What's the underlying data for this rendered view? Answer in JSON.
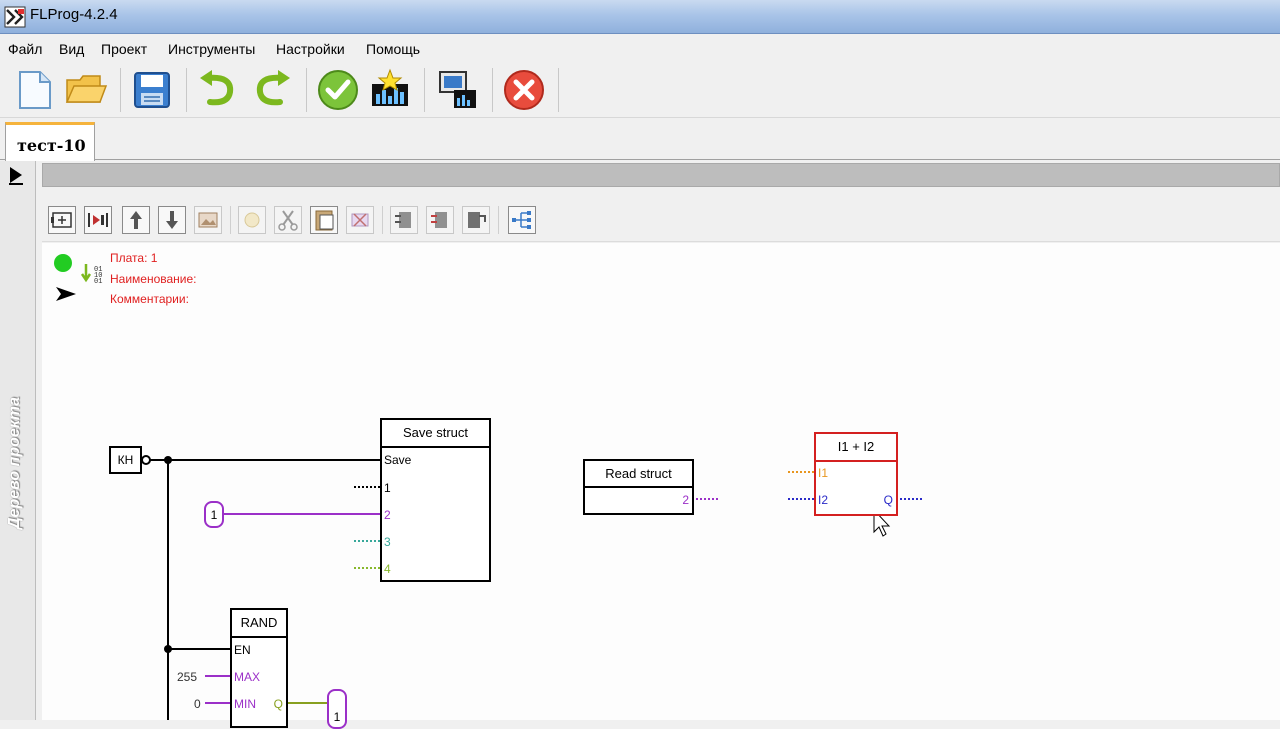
{
  "window": {
    "title": "FLProg-4.2.4"
  },
  "menu": [
    "Файл",
    "Вид",
    "Проект",
    "Инструменты",
    "Настройки",
    "Помощь"
  ],
  "toolbar": [
    {
      "name": "new-file",
      "icon": "new-document-icon"
    },
    {
      "name": "open",
      "icon": "open-folder-icon"
    },
    {
      "name": "save",
      "icon": "floppy-disk-icon"
    },
    {
      "name": "undo",
      "icon": "undo-arrow-icon"
    },
    {
      "name": "redo",
      "icon": "redo-arrow-icon"
    },
    {
      "name": "verify",
      "icon": "green-checkmark-icon"
    },
    {
      "name": "compile",
      "icon": "compile-board-icon"
    },
    {
      "name": "upload",
      "icon": "computer-upload-icon"
    },
    {
      "name": "close",
      "icon": "red-cross-icon"
    }
  ],
  "tabs": [
    {
      "label": "тест-10",
      "active": true
    }
  ],
  "sidebar": {
    "label": "Дерево проекта"
  },
  "board": {
    "plate": "Плата: 1",
    "name": "Наименование:",
    "comment": "Комментарии:",
    "status_color": "#22cc22"
  },
  "blocks": {
    "button": {
      "label": "КН"
    },
    "save_struct": {
      "title": "Save struct",
      "inputs": [
        "Save",
        "1",
        "2",
        "3",
        "4"
      ]
    },
    "read_struct": {
      "title": "Read struct",
      "output": "2"
    },
    "sum": {
      "title": "I1 + I2",
      "inputs": [
        "I1",
        "I2"
      ],
      "output": "Q"
    },
    "rand": {
      "title": "RAND",
      "inputs": [
        "EN",
        "MAX",
        "MIN"
      ],
      "output": "Q"
    },
    "const_1": "1",
    "const_2": "1",
    "rand_max_value": "255",
    "rand_min_value": "0"
  },
  "colors": {
    "wire_black": "#000000",
    "wire_purple": "#9b30c8",
    "wire_teal": "#37a89a",
    "wire_green": "#88b82c",
    "wire_orange": "#e8961f",
    "wire_blue": "#2b2bc8",
    "selected_block": "#d42020"
  }
}
